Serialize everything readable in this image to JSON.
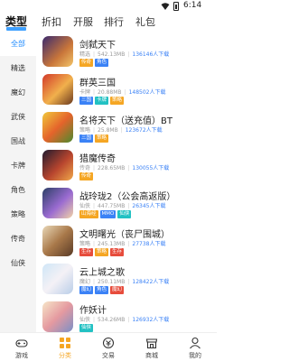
{
  "status_bar": {
    "time": "6:14"
  },
  "top_tabs": [
    {
      "label": "类型",
      "active": true
    },
    {
      "label": "折扣"
    },
    {
      "label": "开服"
    },
    {
      "label": "排行"
    },
    {
      "label": "礼包"
    }
  ],
  "sidebar": [
    {
      "label": "全部",
      "active": true
    },
    {
      "label": "精选"
    },
    {
      "label": "魔幻"
    },
    {
      "label": "武侠"
    },
    {
      "label": "国战"
    },
    {
      "label": "卡牌"
    },
    {
      "label": "角色"
    },
    {
      "label": "策略"
    },
    {
      "label": "传奇"
    },
    {
      "label": "仙侠"
    }
  ],
  "games": [
    {
      "name": "剑弑天下",
      "category": "精选",
      "size": "542.13MB",
      "downloads": "136146人下载",
      "tags": [
        {
          "text": "传奇",
          "color": "#f5a623"
        },
        {
          "text": "角色",
          "color": "#3b82f6"
        }
      ]
    },
    {
      "name": "群英三国",
      "category": "卡牌",
      "size": "20.88MB",
      "downloads": "148502人下载",
      "tags": [
        {
          "text": "三国",
          "color": "#3b82f6"
        },
        {
          "text": "卡牌",
          "color": "#22c1c3"
        },
        {
          "text": "策略",
          "color": "#f5a623"
        }
      ]
    },
    {
      "name": "名将天下（送充值）BT",
      "category": "策略",
      "size": "25.8MB",
      "downloads": "123672人下载",
      "tags": [
        {
          "text": "三国",
          "color": "#3b82f6"
        },
        {
          "text": "策略",
          "color": "#f5a623"
        }
      ]
    },
    {
      "name": "猎魔传奇",
      "category": "传奇",
      "size": "228.65MB",
      "downloads": "130055人下载",
      "tags": [
        {
          "text": "传奇",
          "color": "#f5a623"
        }
      ]
    },
    {
      "name": "战玲珑2（公会高返版）",
      "category": "仙侠",
      "size": "447.75MB",
      "downloads": "26345人下载",
      "tags": [
        {
          "text": "山海经",
          "color": "#f5a623"
        },
        {
          "text": "MMO",
          "color": "#3b82f6"
        },
        {
          "text": "仙侠",
          "color": "#22c1c3"
        }
      ]
    },
    {
      "name": "文明曙光（丧尸围城）",
      "category": "策略",
      "size": "245.13MB",
      "downloads": "27738人下载",
      "tags": [
        {
          "text": "生存",
          "color": "#e74c3c"
        },
        {
          "text": "策略",
          "color": "#f5a623"
        },
        {
          "text": "生存",
          "color": "#e74c3c"
        }
      ]
    },
    {
      "name": "云上城之歌",
      "category": "魔幻",
      "size": "250.11MB",
      "downloads": "128422人下载",
      "tags": [
        {
          "text": "魔幻",
          "color": "#3b82f6"
        },
        {
          "text": "角色",
          "color": "#3b82f6"
        },
        {
          "text": "魔幻",
          "color": "#e74c3c"
        }
      ]
    },
    {
      "name": "作妖计",
      "category": "仙侠",
      "size": "534.26MB",
      "downloads": "126932人下载",
      "tags": [
        {
          "text": "仙侠",
          "color": "#22c1c3"
        }
      ]
    }
  ],
  "bottom_nav": [
    {
      "label": "游戏",
      "icon": "gamepad-icon"
    },
    {
      "label": "分类",
      "icon": "grid-icon",
      "active": true
    },
    {
      "label": "交易",
      "icon": "trade-icon"
    },
    {
      "label": "商城",
      "icon": "shop-icon"
    },
    {
      "label": "我的",
      "icon": "user-icon"
    }
  ],
  "colors": {
    "accent_blue": "#3ea0ff",
    "nav_active": "#f5a623",
    "sidebar_bg": "#f4f4f4"
  }
}
